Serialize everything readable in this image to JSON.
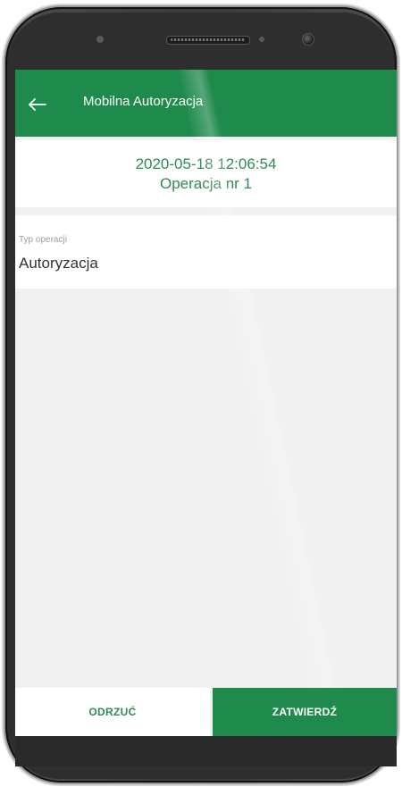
{
  "app_bar": {
    "title": "Mobilna Autoryzacja",
    "back_icon": "arrow-left-icon",
    "color": "#1e8a4c"
  },
  "operation": {
    "datetime": "2020-05-18 12:06:54",
    "number": "Operacja nr 1"
  },
  "field": {
    "label": "Typ operacji",
    "value": "Autoryzacja"
  },
  "actions": {
    "reject_label": "ODRZUĆ",
    "confirm_label": "ZATWIERDŹ"
  },
  "colors": {
    "accent": "#1e8a4c",
    "accent_text": "#2f8b52",
    "background": "#f1f1f1"
  }
}
